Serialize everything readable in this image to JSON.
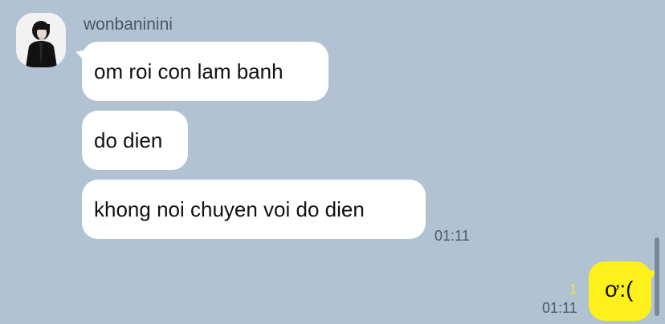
{
  "conversation": {
    "sender": {
      "name": "wonbaninini"
    },
    "incoming": [
      {
        "text": "om roi con lam banh"
      },
      {
        "text": "do dien"
      },
      {
        "text": "khong noi chuyen voi do dien"
      }
    ],
    "incoming_time": "01:11",
    "outgoing": {
      "text": "ơ:(",
      "time": "01:11",
      "unread_count": "1"
    }
  },
  "colors": {
    "background": "#b1c3d3",
    "incoming_bubble": "#ffffff",
    "outgoing_bubble": "#fef01b",
    "unread": "#f6e23b"
  }
}
